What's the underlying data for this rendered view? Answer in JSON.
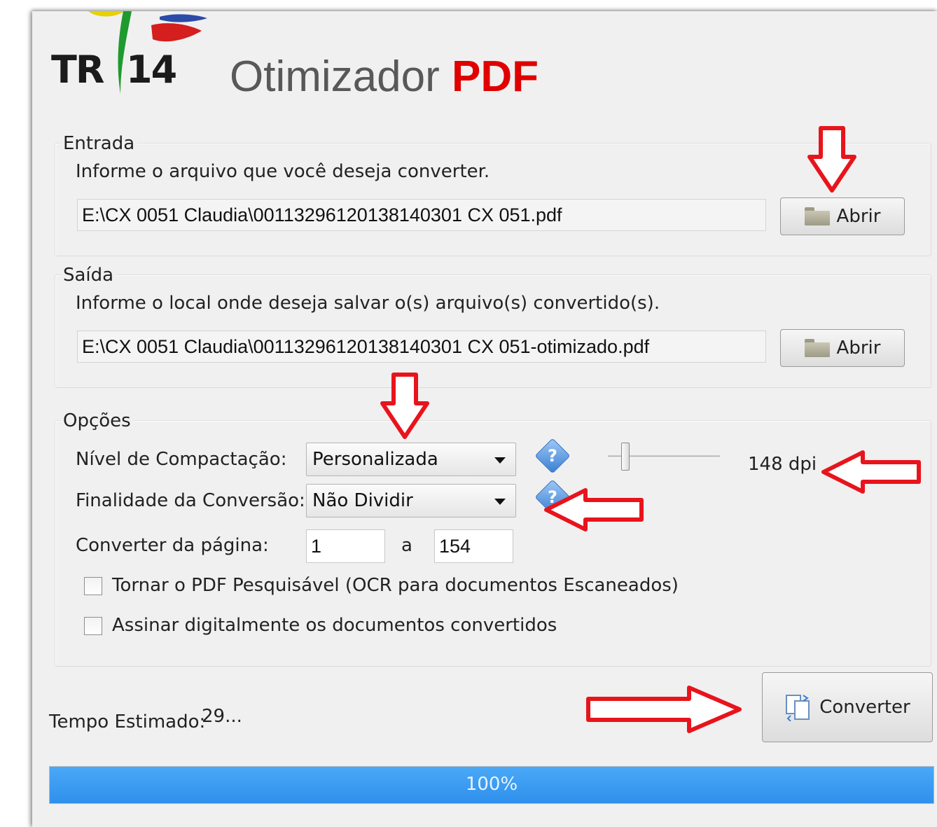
{
  "app": {
    "logo_text_left": "TR",
    "logo_text_right": "14",
    "title_main": "Otimizador",
    "title_accent": "PDF"
  },
  "entrada": {
    "legend": "Entrada",
    "instruction": "Informe o arquivo que você deseja converter.",
    "path_value": "E:\\CX 0051 Claudia\\00113296120138140301   CX 051.pdf",
    "open_label": "Abrir"
  },
  "saida": {
    "legend": "Saída",
    "instruction": "Informe o local onde deseja salvar o(s) arquivo(s) convertido(s).",
    "path_value": "E:\\CX 0051 Claudia\\00113296120138140301   CX 051-otimizado.pdf",
    "open_label": "Abrir"
  },
  "opcoes": {
    "legend": "Opções",
    "compression_label": "Nível de Compactação:",
    "compression_value": "Personalizada",
    "dpi_label": "148 dpi",
    "dpi_slider_fraction": 0.13,
    "purpose_label": "Finalidade da Conversão:",
    "purpose_value": "Não Dividir",
    "page_range_label": "Converter da página:",
    "page_from": "1",
    "page_to_separator": "a",
    "page_to": "154",
    "ocr_label": "Tornar o PDF Pesquisável (OCR para documentos Escaneados)",
    "ocr_checked": false,
    "sign_label": "Assinar digitalmente os documentos convertidos",
    "sign_checked": false
  },
  "footer": {
    "estimate_label": "Tempo Estimado:",
    "estimate_value": "29...",
    "convert_label": "Converter",
    "progress_text": "100%",
    "progress_fraction": 1.0
  },
  "colors": {
    "accent_red": "#e00000",
    "annotation_red": "#e8141c",
    "progress_blue": "#3a9af0",
    "help_blue": "#3a7fd4"
  }
}
